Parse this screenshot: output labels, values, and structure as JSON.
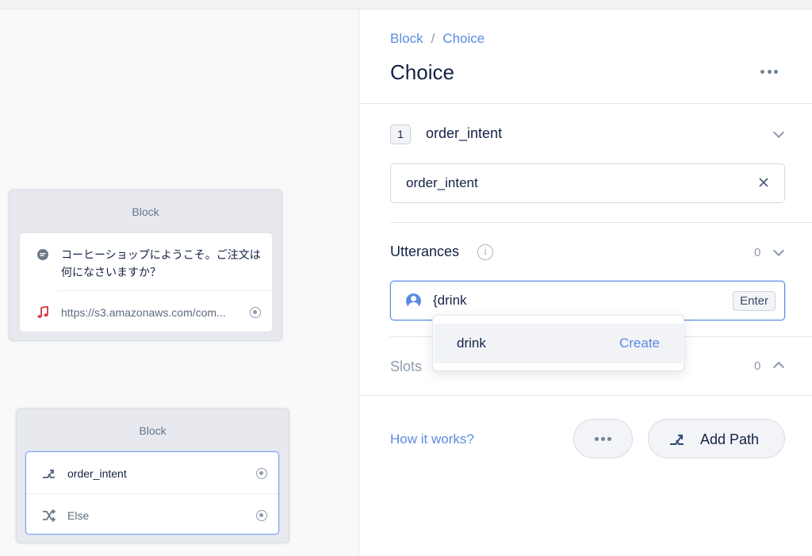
{
  "canvas": {
    "block1": {
      "title": "Block",
      "speak_text": "コーヒーショップにようこそ。ご注文は何になさいますか？",
      "audio_url": "https://s3.amazonaws.com/com..."
    },
    "block2": {
      "title": "Block",
      "paths": [
        {
          "label": "order_intent",
          "icon": "path-icon"
        },
        {
          "label": "Else",
          "icon": "shuffle-icon"
        }
      ]
    }
  },
  "editor": {
    "breadcrumb": {
      "parent": "Block",
      "separator": "/",
      "current": "Choice"
    },
    "title": "Choice",
    "choice": {
      "number": "1",
      "name": "order_intent",
      "intent_value": "order_intent"
    },
    "utterances": {
      "label": "Utterances",
      "info": "i",
      "count": "0",
      "input_value": "{drink",
      "enter_hint": "Enter"
    },
    "suggestion": {
      "label": "drink",
      "action": "Create"
    },
    "slots": {
      "label": "Slots",
      "count": "0"
    },
    "footer": {
      "help_link": "How it works?",
      "add_path_label": "Add Path"
    }
  },
  "colors": {
    "accent": "#5b8be0",
    "text": "#132144",
    "muted": "#8f9bad",
    "audio": "#e0434f"
  }
}
